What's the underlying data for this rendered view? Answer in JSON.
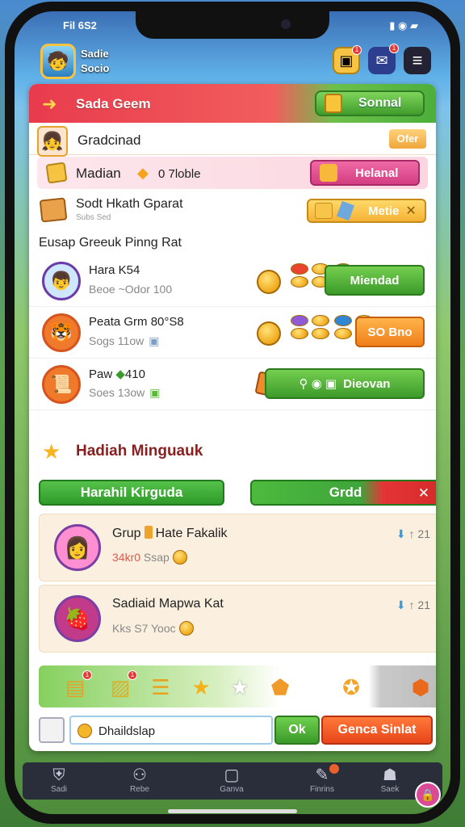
{
  "status": {
    "time": "Fil 6S2"
  },
  "hud": {
    "player_name": "Sadie",
    "player_sub": "Socio"
  },
  "panel": {
    "title": "Sada Geem",
    "signal_label": "Sonnal",
    "guild": {
      "name": "Gradcinad",
      "ok": "Ofer"
    },
    "median": {
      "label": "Madian",
      "count": "0 7loble",
      "button": "Helanal"
    },
    "shard": {
      "title": "Sodt Hkath Gparat",
      "sub": "Subs Sed",
      "button": "Metie"
    },
    "section_title": "Eusap Greeuk Pinng Rat",
    "members": [
      {
        "name": "Hara K54",
        "sub": "Beoe ~Odor 100",
        "action": "Miendad",
        "action_color": "#3c9a2a"
      },
      {
        "name": "Peata Grm 80°S8",
        "sub": "Sogs 11ow",
        "action": "SO Bno",
        "action_color": "#f07f1a"
      },
      {
        "name": "Paw",
        "name_extra": "410",
        "sub": "Soes 13ow",
        "action": "Dieovan",
        "action_color": "#3c9a2a"
      }
    ],
    "reward_title": "Hadiah Minguauk",
    "tabs": {
      "left": "Harahil Kirguda",
      "right": "Grdd"
    },
    "cards": [
      {
        "title_a": "Grup",
        "title_b": "Hate Fakalik",
        "sub_red": "34kr0",
        "sub": "Ssap",
        "arrow": "21"
      },
      {
        "title_a": "Sadiaid Mapwa Kat",
        "title_b": "",
        "sub_red": "",
        "sub": "Kks S7 Yooc",
        "arrow": "21"
      }
    ],
    "footer": {
      "input_value": "Dhaildslap",
      "ok": "Ok",
      "send": "Genca Sinlat"
    }
  },
  "nav": [
    {
      "label": "Sadi",
      "icon": "shield-icon"
    },
    {
      "label": "Rebe",
      "icon": "people-icon"
    },
    {
      "label": "Ganva",
      "icon": "square-icon"
    },
    {
      "label": "Finrins",
      "icon": "scroll-icon"
    },
    {
      "label": "Saek",
      "icon": "bag-icon"
    }
  ]
}
